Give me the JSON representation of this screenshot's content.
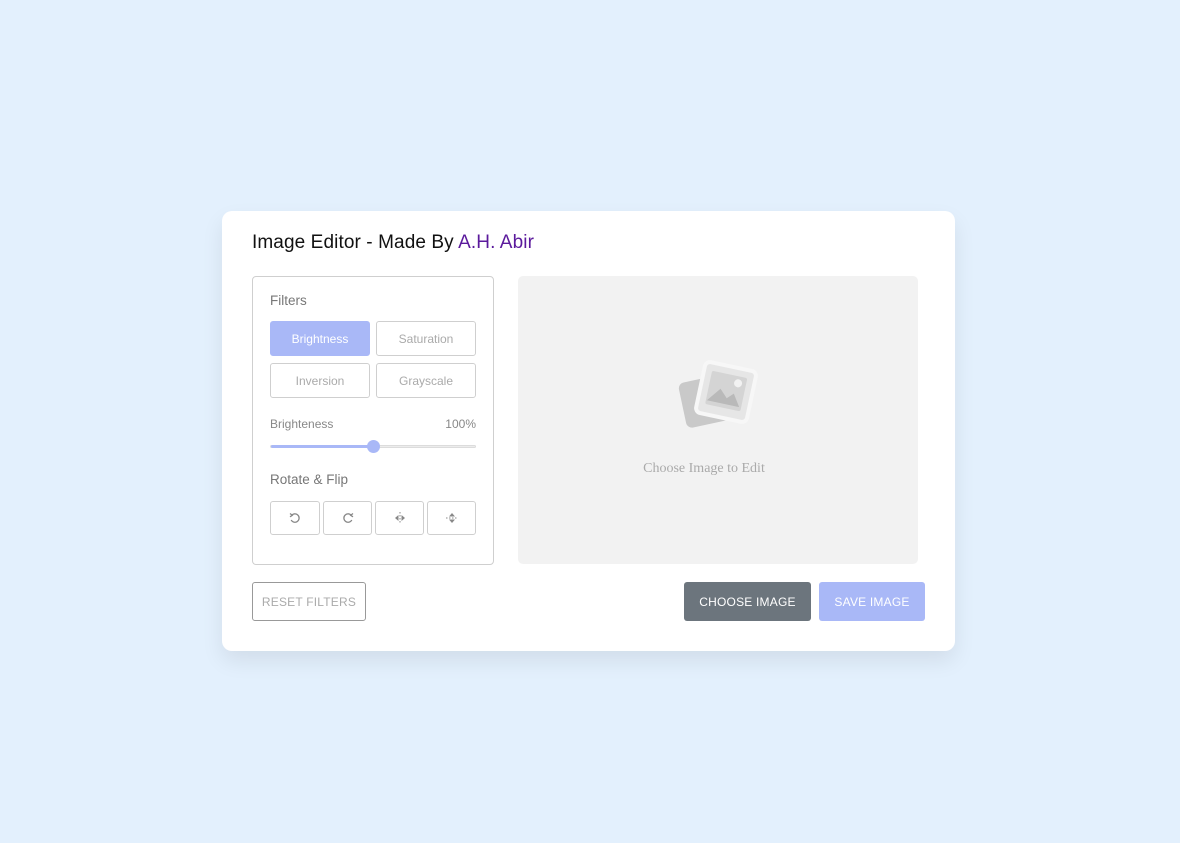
{
  "header": {
    "title_prefix": "Image Editor - Made By ",
    "title_author": "A.H. Abir"
  },
  "filters": {
    "section_title": "Filters",
    "buttons": [
      "Brightness",
      "Saturation",
      "Inversion",
      "Grayscale"
    ],
    "active": "Brightness",
    "slider": {
      "label": "Brighteness",
      "value_text": "100%",
      "value_fraction": 0.5
    }
  },
  "rotate": {
    "section_title": "Rotate & Flip",
    "buttons": [
      "rotate-left-icon",
      "rotate-right-icon",
      "flip-horizontal-icon",
      "flip-vertical-icon"
    ]
  },
  "preview": {
    "placeholder_text": "Choose Image to Edit",
    "icon": "image-placeholder-icon"
  },
  "actions": {
    "reset_label": "Reset Filters",
    "choose_label": "Choose Image",
    "save_label": "Save Image"
  },
  "colors": {
    "accent": "#a9b8f7",
    "author": "#5b1a9c",
    "choose_button": "#6c757d",
    "background": "#e3f0fd"
  }
}
